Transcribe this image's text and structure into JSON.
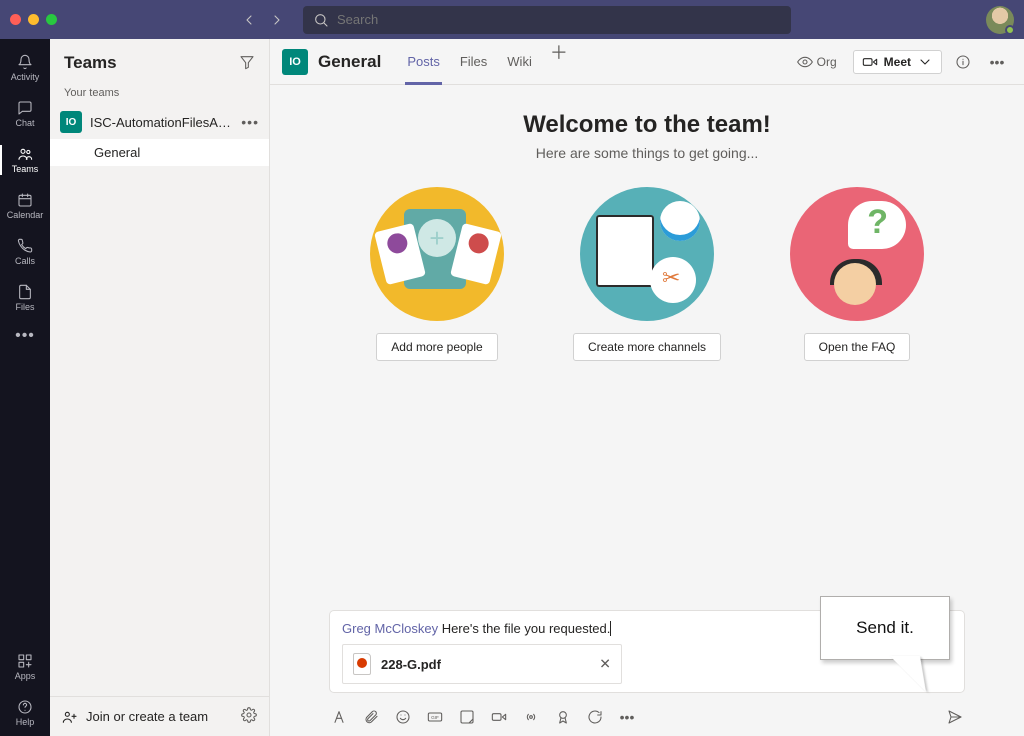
{
  "titlebar": {
    "search_placeholder": "Search"
  },
  "rail": {
    "items": [
      {
        "label": "Activity"
      },
      {
        "label": "Chat"
      },
      {
        "label": "Teams"
      },
      {
        "label": "Calendar"
      },
      {
        "label": "Calls"
      },
      {
        "label": "Files"
      }
    ],
    "apps_label": "Apps",
    "help_label": "Help"
  },
  "sidebar": {
    "title": "Teams",
    "section_label": "Your teams",
    "team": {
      "initials": "IO",
      "name": "ISC-AutomationFilesAnd..."
    },
    "channel": {
      "name": "General"
    },
    "join_label": "Join or create a team"
  },
  "content": {
    "channel_initials": "IO",
    "channel_title": "General",
    "tabs": [
      {
        "label": "Posts"
      },
      {
        "label": "Files"
      },
      {
        "label": "Wiki"
      }
    ],
    "org_label": "Org",
    "meet_label": "Meet",
    "welcome_title": "Welcome to the team!",
    "welcome_sub": "Here are some things to get going...",
    "card1_button": "Add more people",
    "card2_button": "Create more channels",
    "card3_button": "Open the FAQ"
  },
  "compose": {
    "mention": "Greg McCloskey",
    "message": " Here's the file you requested.",
    "attachment_name": "228-G.pdf"
  },
  "callout": {
    "text": "Send it."
  }
}
